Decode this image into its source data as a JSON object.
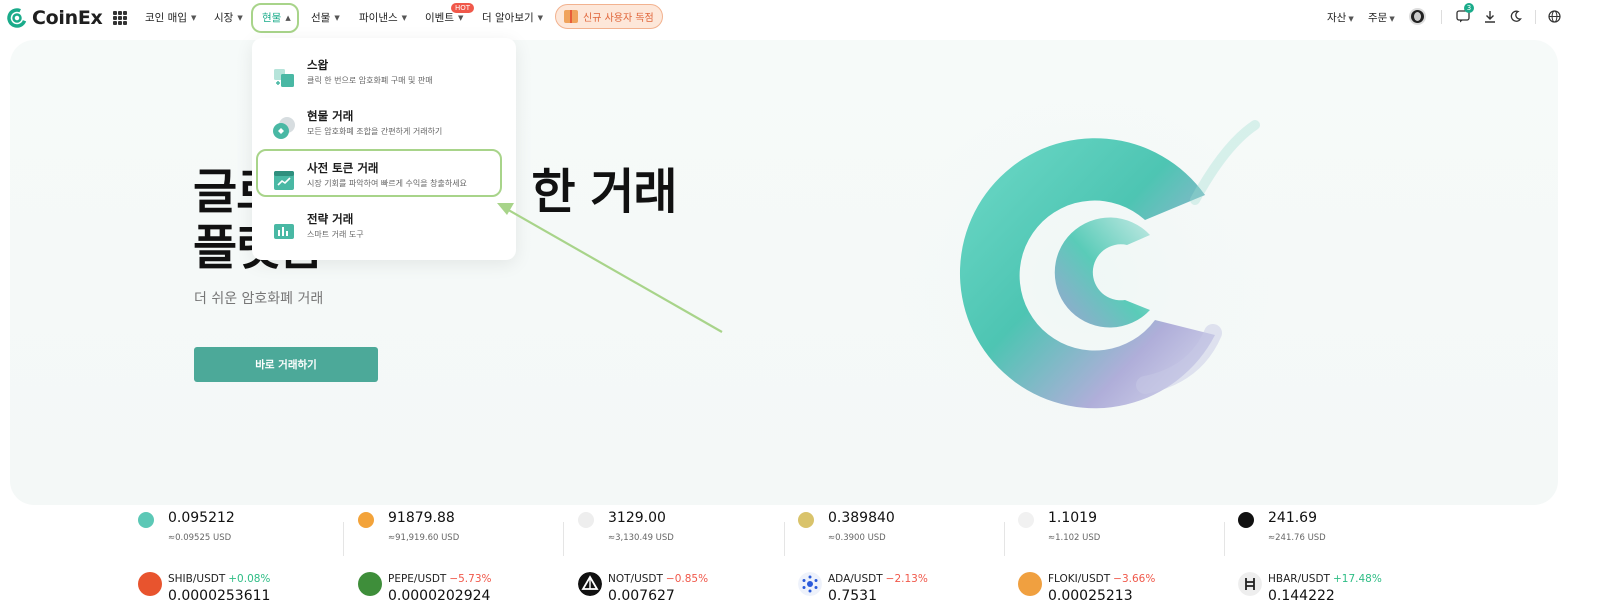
{
  "brand": {
    "name": "CoinEx"
  },
  "nav": {
    "items": [
      {
        "label": "코인 매입"
      },
      {
        "label": "시장"
      },
      {
        "label": "현물"
      },
      {
        "label": "선물"
      },
      {
        "label": "파이낸스"
      },
      {
        "label": "이벤트"
      },
      {
        "label": "더 알아보기"
      }
    ],
    "hot_badge": "HOT",
    "promo_label": "신규 사용자 독점",
    "assets_label": "자산",
    "orders_label": "주문",
    "notification_count": "3"
  },
  "dropdown": {
    "items": [
      {
        "title": "스왑",
        "desc": "클릭 한 번으로 암호화폐 구매 및 판매"
      },
      {
        "title": "현물 거래",
        "desc": "모든 암호화폐 조합을 간편하게 거래하기"
      },
      {
        "title": "사전 토큰 거래",
        "desc": "시장 기회를 파악하여 빠르게 수익을 창출하세요"
      },
      {
        "title": "전략 거래",
        "desc": "스마트 거래 도구"
      }
    ]
  },
  "hero": {
    "title_line1_visible_left": "글로",
    "title_line1_visible_right": "한 거래",
    "title_line2": "플랫폼",
    "subtitle": "더 쉬운 암호화폐 거래",
    "cta_label": "바로 거래하기"
  },
  "ticker": {
    "top_row": [
      {
        "price": "0.095212",
        "usd": "≈0.09525 USD"
      },
      {
        "price": "91879.88",
        "usd": "≈91,919.60 USD"
      },
      {
        "price": "3129.00",
        "usd": "≈3,130.49 USD"
      },
      {
        "price": "0.389840",
        "usd": "≈0.3900 USD"
      },
      {
        "price": "1.1019",
        "usd": "≈1.102 USD"
      },
      {
        "price": "241.69",
        "usd": "≈241.76 USD"
      }
    ],
    "bottom_row": [
      {
        "pair": "SHIB/USDT",
        "change": "+0.08%",
        "price": "0.0000253611",
        "color": "#e8542e"
      },
      {
        "pair": "PEPE/USDT",
        "change": "−5.73%",
        "price": "0.0000202924",
        "color": "#3e8e3a"
      },
      {
        "pair": "NOT/USDT",
        "change": "−0.85%",
        "price": "0.007627",
        "color": "#111111"
      },
      {
        "pair": "ADA/USDT",
        "change": "−2.13%",
        "price": "0.7531",
        "color": "#2a5ada"
      },
      {
        "pair": "FLOKI/USDT",
        "change": "−3.66%",
        "price": "0.00025213",
        "color": "#f0a040"
      },
      {
        "pair": "HBAR/USDT",
        "change": "+17.48%",
        "price": "0.144222",
        "color": "#222222"
      }
    ],
    "up_color": "#2ebd85",
    "down_color": "#f0584a"
  }
}
